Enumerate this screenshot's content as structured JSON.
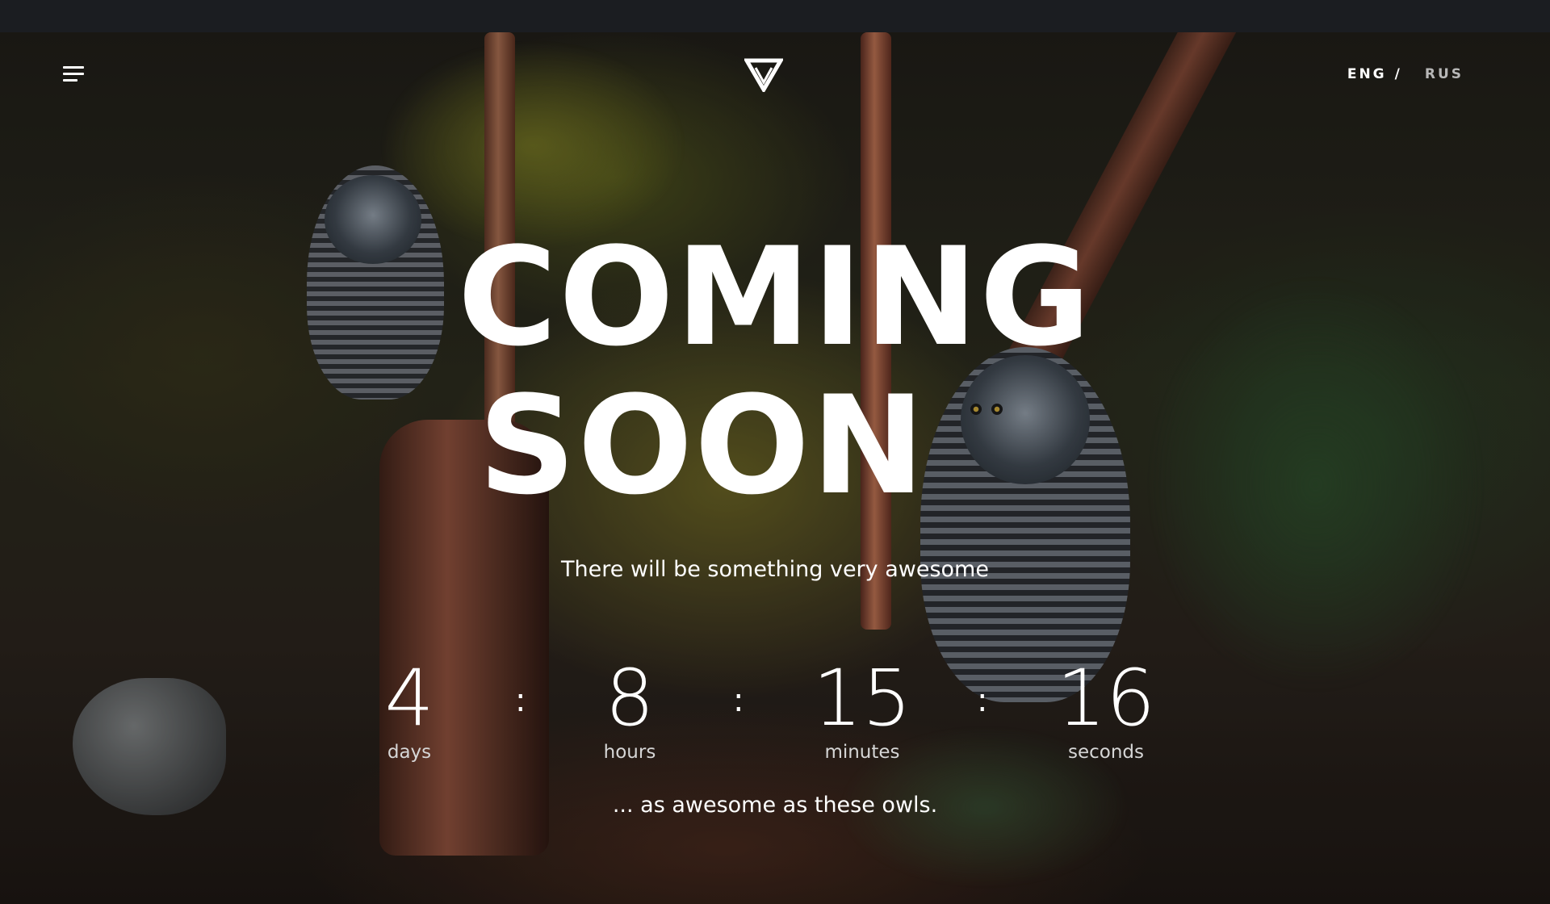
{
  "header": {
    "menu_icon": "hamburger-menu-icon",
    "logo_icon": "triangle-logo-icon",
    "lang": {
      "active": "ENG",
      "separator": "/",
      "inactive": "RUS"
    }
  },
  "hero": {
    "title_line1": "COMING",
    "title_line2": "SOON",
    "subtitle": "There will be something very awesome",
    "tagline": "... as awesome as these owls."
  },
  "countdown": {
    "separator": ":",
    "days": {
      "value": "4",
      "label": "days"
    },
    "hours": {
      "value": "8",
      "label": "hours"
    },
    "minutes": {
      "value": "15",
      "label": "minutes"
    },
    "seconds": {
      "value": "16",
      "label": "seconds"
    }
  },
  "colors": {
    "text": "#ffffff",
    "topbar": "#1b1d21"
  }
}
